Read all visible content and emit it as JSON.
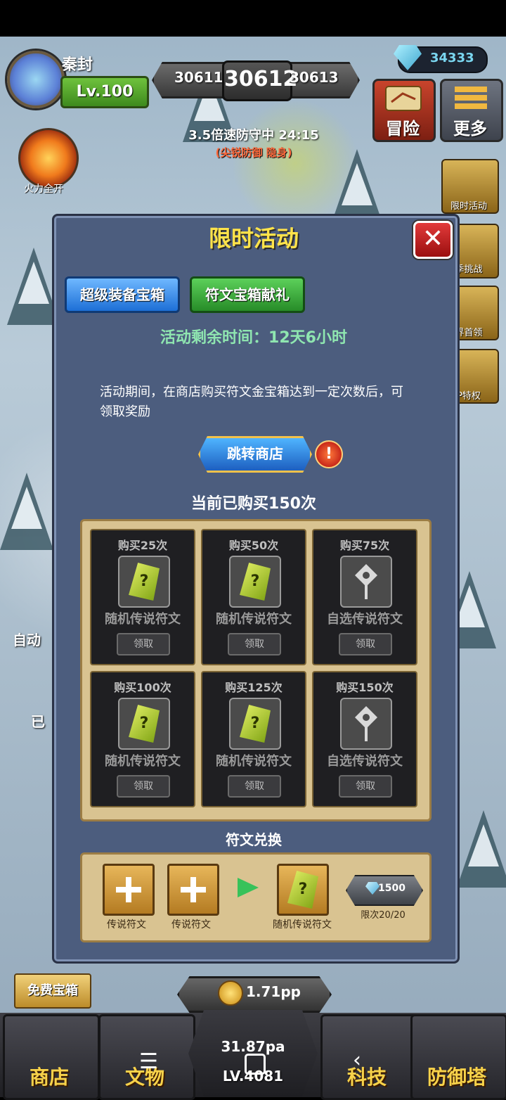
{
  "player": {
    "name": "秦封",
    "level": "Lv.100"
  },
  "firepower": {
    "label": "火力全开"
  },
  "waves": {
    "prev": "30611",
    "current": "30612",
    "next": "30613"
  },
  "defense": {
    "speed_text": "3.5倍速防守中 24:15",
    "sub_text": "(尖锐防御 隐身)"
  },
  "currency": {
    "gems": "34333"
  },
  "top_buttons": {
    "adventure": "冒险",
    "more": "更多"
  },
  "side_menu": [
    "限时活动",
    "季挑战",
    "界首领",
    "P特权"
  ],
  "left_partial": [
    "自动",
    "已"
  ],
  "modal": {
    "title": "限时活动",
    "close": "✕",
    "tabs": [
      "超级装备宝箱",
      "符文宝箱献礼"
    ],
    "remaining": "活动剩余时间：12天6小时",
    "description": "活动期间，在商店购买符文金宝箱达到一定次数后，可领取奖励",
    "jump_button": "跳转商店",
    "warning": "!",
    "bought": "当前已购买150次",
    "rewards": [
      {
        "title": "购买25次",
        "name": "随机传说符文",
        "claim": "领取",
        "type": "random"
      },
      {
        "title": "购买50次",
        "name": "随机传说符文",
        "claim": "领取",
        "type": "random"
      },
      {
        "title": "购买75次",
        "name": "自选传说符文",
        "claim": "领取",
        "type": "select"
      },
      {
        "title": "购买100次",
        "name": "随机传说符文",
        "claim": "领取",
        "type": "random"
      },
      {
        "title": "购买125次",
        "name": "随机传说符文",
        "claim": "领取",
        "type": "random"
      },
      {
        "title": "购买150次",
        "name": "自选传说符文",
        "claim": "领取",
        "type": "select"
      }
    ],
    "exchange": {
      "title": "符文兑换",
      "input1": "传说符文",
      "input2": "传说符文",
      "output": "随机传说符文",
      "price": "1500",
      "limit": "限次20/20"
    }
  },
  "bottom": {
    "free_chest": "免费宝箱",
    "pp_rate": "1.71pp",
    "power": "31.87pa",
    "hero_level": "LV.4081",
    "nav": [
      "商店",
      "文物",
      "科技",
      "防御塔"
    ]
  },
  "colors": {
    "title_yellow": "#ffe34a",
    "remain_green": "#8fe6b0",
    "modal_bg": "#4c5d7e",
    "parchment": "#d9c391"
  }
}
